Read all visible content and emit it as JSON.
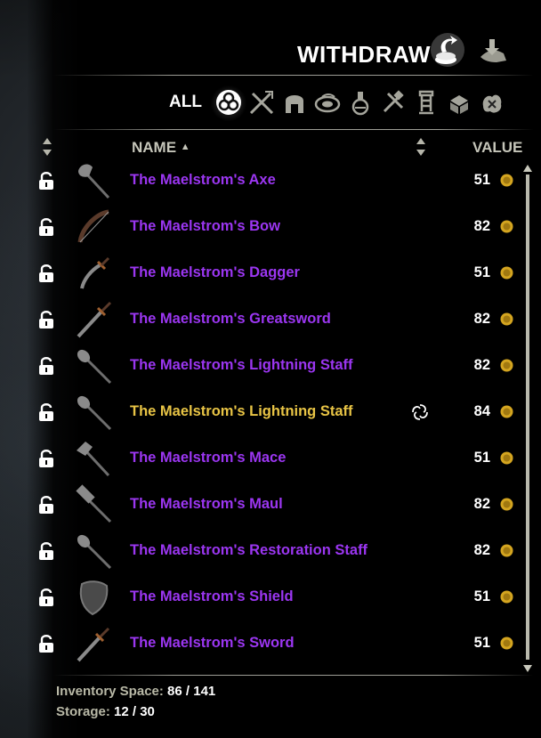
{
  "header": {
    "title": "WITHDRAW",
    "mode_icons": [
      "withdraw-icon",
      "deposit-icon"
    ]
  },
  "filters": {
    "all_label": "ALL",
    "icons": [
      "all-items-icon",
      "weapons-icon",
      "apparel-icon",
      "consumables-icon",
      "materials-icon",
      "furnishing-icon",
      "quest-items-icon",
      "crafting-station-icon",
      "junk-icon"
    ]
  },
  "columns": {
    "name": "NAME",
    "name_sort_indicator": "▲",
    "value": "VALUE"
  },
  "items": [
    {
      "name": "The Maelstrom's Axe",
      "value": "51",
      "icon": "axe-icon",
      "quality_color": "#9b36f1",
      "locked": true
    },
    {
      "name": "The Maelstrom's Bow",
      "value": "82",
      "icon": "bow-icon",
      "quality_color": "#9b36f1",
      "locked": true
    },
    {
      "name": "The Maelstrom's Dagger",
      "value": "51",
      "icon": "dagger-icon",
      "quality_color": "#9b36f1",
      "locked": true
    },
    {
      "name": "The Maelstrom's Greatsword",
      "value": "82",
      "icon": "greatsword-icon",
      "quality_color": "#9b36f1",
      "locked": true
    },
    {
      "name": "The Maelstrom's Lightning Staff",
      "value": "82",
      "icon": "staff-icon",
      "quality_color": "#9b36f1",
      "locked": true
    },
    {
      "name": "The Maelstrom's Lightning Staff",
      "value": "84",
      "icon": "staff-icon",
      "quality_color": "#e8c445",
      "locked": true,
      "trait_icon": "research-trait-icon"
    },
    {
      "name": "The Maelstrom's Mace",
      "value": "51",
      "icon": "mace-icon",
      "quality_color": "#9b36f1",
      "locked": true
    },
    {
      "name": "The Maelstrom's Maul",
      "value": "82",
      "icon": "maul-icon",
      "quality_color": "#9b36f1",
      "locked": true
    },
    {
      "name": "The Maelstrom's Restoration Staff",
      "value": "82",
      "icon": "staff-icon",
      "quality_color": "#9b36f1",
      "locked": true
    },
    {
      "name": "The Maelstrom's Shield",
      "value": "51",
      "icon": "shield-icon",
      "quality_color": "#9b36f1",
      "locked": true
    },
    {
      "name": "The Maelstrom's Sword",
      "value": "51",
      "icon": "sword-icon",
      "quality_color": "#9b36f1",
      "locked": true
    }
  ],
  "footer": {
    "inventory_label": "Inventory Space:",
    "inventory_value": "86 / 141",
    "storage_label": "Storage:",
    "storage_value": "12 / 30"
  },
  "colors": {
    "epic": "#9b36f1",
    "legendary": "#e8c445",
    "header_text": "#c5c5b9",
    "gold_coin": "#d4a520"
  }
}
